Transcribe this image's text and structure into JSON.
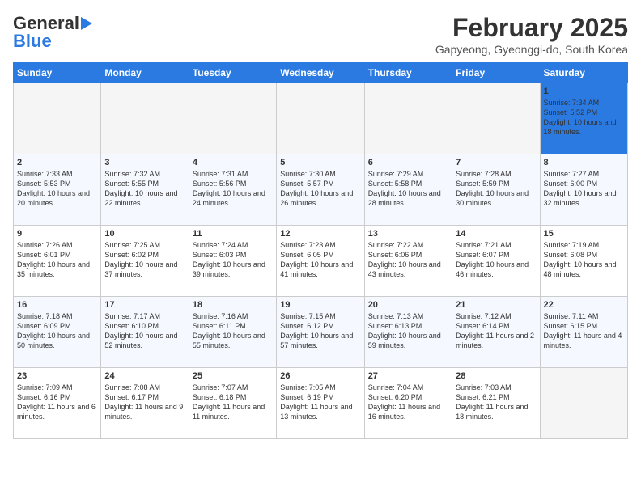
{
  "header": {
    "logo_line1": "General",
    "logo_line2": "Blue",
    "month": "February 2025",
    "location": "Gapyeong, Gyeonggi-do, South Korea"
  },
  "days_of_week": [
    "Sunday",
    "Monday",
    "Tuesday",
    "Wednesday",
    "Thursday",
    "Friday",
    "Saturday"
  ],
  "weeks": [
    [
      {
        "day": "",
        "info": ""
      },
      {
        "day": "",
        "info": ""
      },
      {
        "day": "",
        "info": ""
      },
      {
        "day": "",
        "info": ""
      },
      {
        "day": "",
        "info": ""
      },
      {
        "day": "",
        "info": ""
      },
      {
        "day": "1",
        "info": "Sunrise: 7:34 AM\nSunset: 5:52 PM\nDaylight: 10 hours and 18 minutes."
      }
    ],
    [
      {
        "day": "2",
        "info": "Sunrise: 7:33 AM\nSunset: 5:53 PM\nDaylight: 10 hours and 20 minutes."
      },
      {
        "day": "3",
        "info": "Sunrise: 7:32 AM\nSunset: 5:55 PM\nDaylight: 10 hours and 22 minutes."
      },
      {
        "day": "4",
        "info": "Sunrise: 7:31 AM\nSunset: 5:56 PM\nDaylight: 10 hours and 24 minutes."
      },
      {
        "day": "5",
        "info": "Sunrise: 7:30 AM\nSunset: 5:57 PM\nDaylight: 10 hours and 26 minutes."
      },
      {
        "day": "6",
        "info": "Sunrise: 7:29 AM\nSunset: 5:58 PM\nDaylight: 10 hours and 28 minutes."
      },
      {
        "day": "7",
        "info": "Sunrise: 7:28 AM\nSunset: 5:59 PM\nDaylight: 10 hours and 30 minutes."
      },
      {
        "day": "8",
        "info": "Sunrise: 7:27 AM\nSunset: 6:00 PM\nDaylight: 10 hours and 32 minutes."
      }
    ],
    [
      {
        "day": "9",
        "info": "Sunrise: 7:26 AM\nSunset: 6:01 PM\nDaylight: 10 hours and 35 minutes."
      },
      {
        "day": "10",
        "info": "Sunrise: 7:25 AM\nSunset: 6:02 PM\nDaylight: 10 hours and 37 minutes."
      },
      {
        "day": "11",
        "info": "Sunrise: 7:24 AM\nSunset: 6:03 PM\nDaylight: 10 hours and 39 minutes."
      },
      {
        "day": "12",
        "info": "Sunrise: 7:23 AM\nSunset: 6:05 PM\nDaylight: 10 hours and 41 minutes."
      },
      {
        "day": "13",
        "info": "Sunrise: 7:22 AM\nSunset: 6:06 PM\nDaylight: 10 hours and 43 minutes."
      },
      {
        "day": "14",
        "info": "Sunrise: 7:21 AM\nSunset: 6:07 PM\nDaylight: 10 hours and 46 minutes."
      },
      {
        "day": "15",
        "info": "Sunrise: 7:19 AM\nSunset: 6:08 PM\nDaylight: 10 hours and 48 minutes."
      }
    ],
    [
      {
        "day": "16",
        "info": "Sunrise: 7:18 AM\nSunset: 6:09 PM\nDaylight: 10 hours and 50 minutes."
      },
      {
        "day": "17",
        "info": "Sunrise: 7:17 AM\nSunset: 6:10 PM\nDaylight: 10 hours and 52 minutes."
      },
      {
        "day": "18",
        "info": "Sunrise: 7:16 AM\nSunset: 6:11 PM\nDaylight: 10 hours and 55 minutes."
      },
      {
        "day": "19",
        "info": "Sunrise: 7:15 AM\nSunset: 6:12 PM\nDaylight: 10 hours and 57 minutes."
      },
      {
        "day": "20",
        "info": "Sunrise: 7:13 AM\nSunset: 6:13 PM\nDaylight: 10 hours and 59 minutes."
      },
      {
        "day": "21",
        "info": "Sunrise: 7:12 AM\nSunset: 6:14 PM\nDaylight: 11 hours and 2 minutes."
      },
      {
        "day": "22",
        "info": "Sunrise: 7:11 AM\nSunset: 6:15 PM\nDaylight: 11 hours and 4 minutes."
      }
    ],
    [
      {
        "day": "23",
        "info": "Sunrise: 7:09 AM\nSunset: 6:16 PM\nDaylight: 11 hours and 6 minutes."
      },
      {
        "day": "24",
        "info": "Sunrise: 7:08 AM\nSunset: 6:17 PM\nDaylight: 11 hours and 9 minutes."
      },
      {
        "day": "25",
        "info": "Sunrise: 7:07 AM\nSunset: 6:18 PM\nDaylight: 11 hours and 11 minutes."
      },
      {
        "day": "26",
        "info": "Sunrise: 7:05 AM\nSunset: 6:19 PM\nDaylight: 11 hours and 13 minutes."
      },
      {
        "day": "27",
        "info": "Sunrise: 7:04 AM\nSunset: 6:20 PM\nDaylight: 11 hours and 16 minutes."
      },
      {
        "day": "28",
        "info": "Sunrise: 7:03 AM\nSunset: 6:21 PM\nDaylight: 11 hours and 18 minutes."
      },
      {
        "day": "",
        "info": ""
      }
    ]
  ]
}
